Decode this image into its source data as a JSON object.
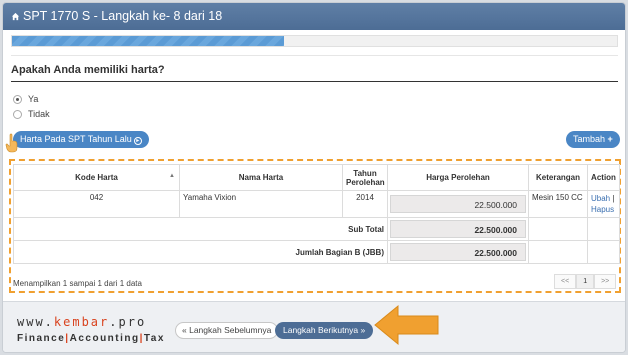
{
  "header": {
    "title": "SPT 1770 S - Langkah ke- 8 dari 18",
    "icon": "home-icon"
  },
  "progress": {
    "fraction": 0.45
  },
  "question": {
    "text": "Apakah Anda memiliki harta?"
  },
  "options": [
    {
      "label": "Ya",
      "selected": true
    },
    {
      "label": "Tidak",
      "selected": false
    }
  ],
  "buttons": {
    "prior_year": "Harta Pada SPT Tahun Lalu",
    "add": "Tambah",
    "prev": "« Langkah Sebelumnya",
    "next": "Langkah Berikutnya »"
  },
  "table": {
    "columns": [
      "Kode Harta",
      "Nama Harta",
      "Tahun Perolehan",
      "Harga Perolehan",
      "Keterangan",
      "Action"
    ],
    "rows": [
      {
        "kode": "042",
        "nama": "Yamaha Vixion",
        "tahun": "2014",
        "harga": "22.500.000",
        "keterangan": "Mesin 150 CC",
        "edit": "Ubah",
        "sep": "|",
        "delete": "Hapus"
      }
    ],
    "subtotal_label": "Sub Total",
    "subtotal_value": "22.500.000",
    "total_label": "Jumlah Bagian B (JBB)",
    "total_value": "22.500.000"
  },
  "pagination": {
    "info": "Menampilkan 1 sampai 1 dari 1 data",
    "prev": "<<",
    "current": "1",
    "next": ">>"
  },
  "brand": {
    "line1_prefix": "www.",
    "line1_accent": "kembar",
    "line1_suffix": ".pro",
    "line2_a": "Finance",
    "line2_sep1": "|",
    "line2_b": "Accounting",
    "line2_sep2": "|",
    "line2_c": "Tax"
  },
  "colors": {
    "header": "#5577a0",
    "button": "#4a86c5",
    "accent": "#f0a030",
    "brand_accent": "#d9431f"
  }
}
